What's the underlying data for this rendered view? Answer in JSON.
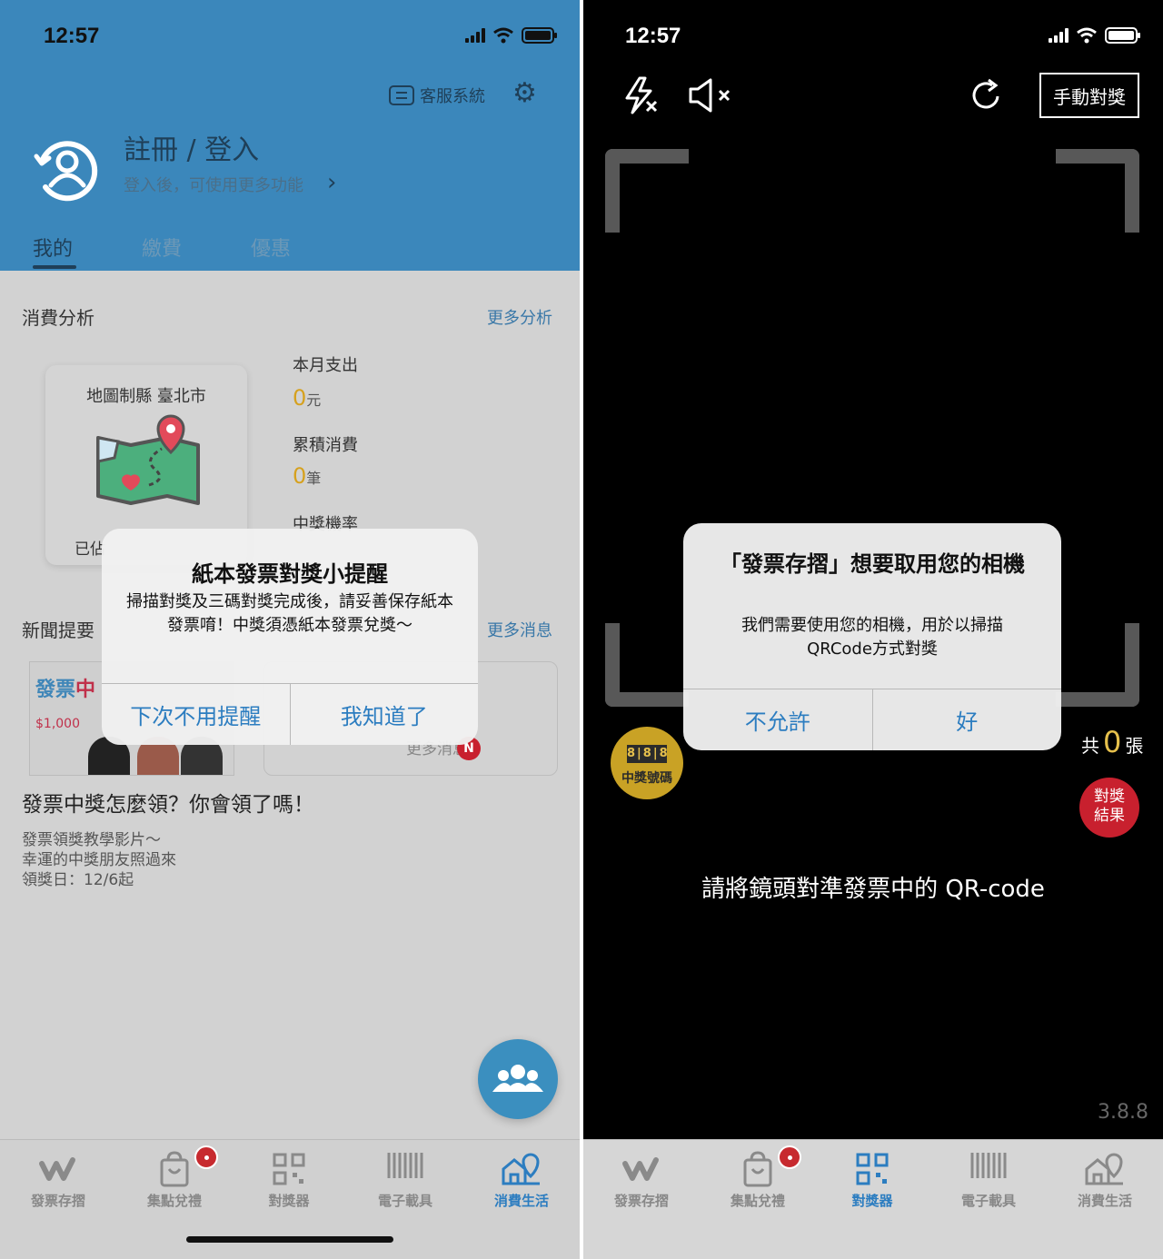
{
  "left": {
    "status": {
      "time": "12:57"
    },
    "header": {
      "customer_service": "客服系統",
      "register_title": "註冊 / 登入",
      "register_sub": "登入後，可使用更多功能",
      "tabs": [
        "我的",
        "繳費",
        "優惠"
      ]
    },
    "analysis": {
      "title": "消費分析",
      "more": "更多分析",
      "map_title": "地圖制縣 臺北市",
      "map_status": "已佔",
      "month_label": "本月支出",
      "month_value": "0",
      "month_unit": "元",
      "total_label": "累積消費",
      "total_value": "0",
      "total_unit": "筆",
      "win_rate_label": "中獎機率"
    },
    "news": {
      "title": "新聞提要",
      "more": "更多消息",
      "img_title_a": "發票",
      "img_title_b": "中",
      "img_amount": "$1,000",
      "more_card": "更多消息",
      "badge": "N",
      "headline": "發票中獎怎麼領？你會領了嗎！",
      "desc": [
        "發票領獎教學影片～",
        "幸運的中獎朋友照過來",
        "領獎日：12/6起"
      ]
    },
    "alert": {
      "title": "紙本發票對獎小提醒",
      "message": "掃描對獎及三碼對獎完成後，請妥善保存紙本發票唷！中獎須憑紙本發票兌獎～",
      "btn_left": "下次不用提醒",
      "btn_right": "我知道了"
    },
    "tabbar": [
      "發票存摺",
      "集點兌禮",
      "對獎器",
      "電子載具",
      "消費生活"
    ],
    "active_tab": "消費生活"
  },
  "right": {
    "status": {
      "time": "12:57"
    },
    "manual_button": "手動對獎",
    "alert": {
      "title": "「發票存摺」想要取用您的相機",
      "message": "我們需要使用您的相機，用於以掃描QRCode方式對獎",
      "btn_left": "不允許",
      "btn_right": "好"
    },
    "win_number": {
      "digits": "8|8|8",
      "label": "中獎號碼"
    },
    "count": {
      "prefix": "共",
      "value": "0",
      "suffix": "張"
    },
    "result_button": [
      "對獎",
      "結果"
    ],
    "hint": "請將鏡頭對準發票中的 QR-code",
    "version": "3.8.8",
    "tabbar": [
      "發票存摺",
      "集點兌禮",
      "對獎器",
      "電子載具",
      "消費生活"
    ],
    "active_tab": "對獎器"
  },
  "colors": {
    "header_blue": "#3b87bb",
    "accent_blue": "#2c7dc0",
    "gold": "#d6a11e",
    "red": "#c8202e"
  },
  "icons": [
    "signal-icon",
    "wifi-icon",
    "battery-icon",
    "customer-service-icon",
    "gear-icon",
    "avatar-icon",
    "chevron-right-icon",
    "map-icon",
    "group-icon",
    "flash-off-icon",
    "mute-icon",
    "rotate-icon",
    "invoice-w-icon",
    "shopping-bag-icon",
    "qr-code-icon",
    "barcode-icon",
    "shop-location-icon"
  ]
}
